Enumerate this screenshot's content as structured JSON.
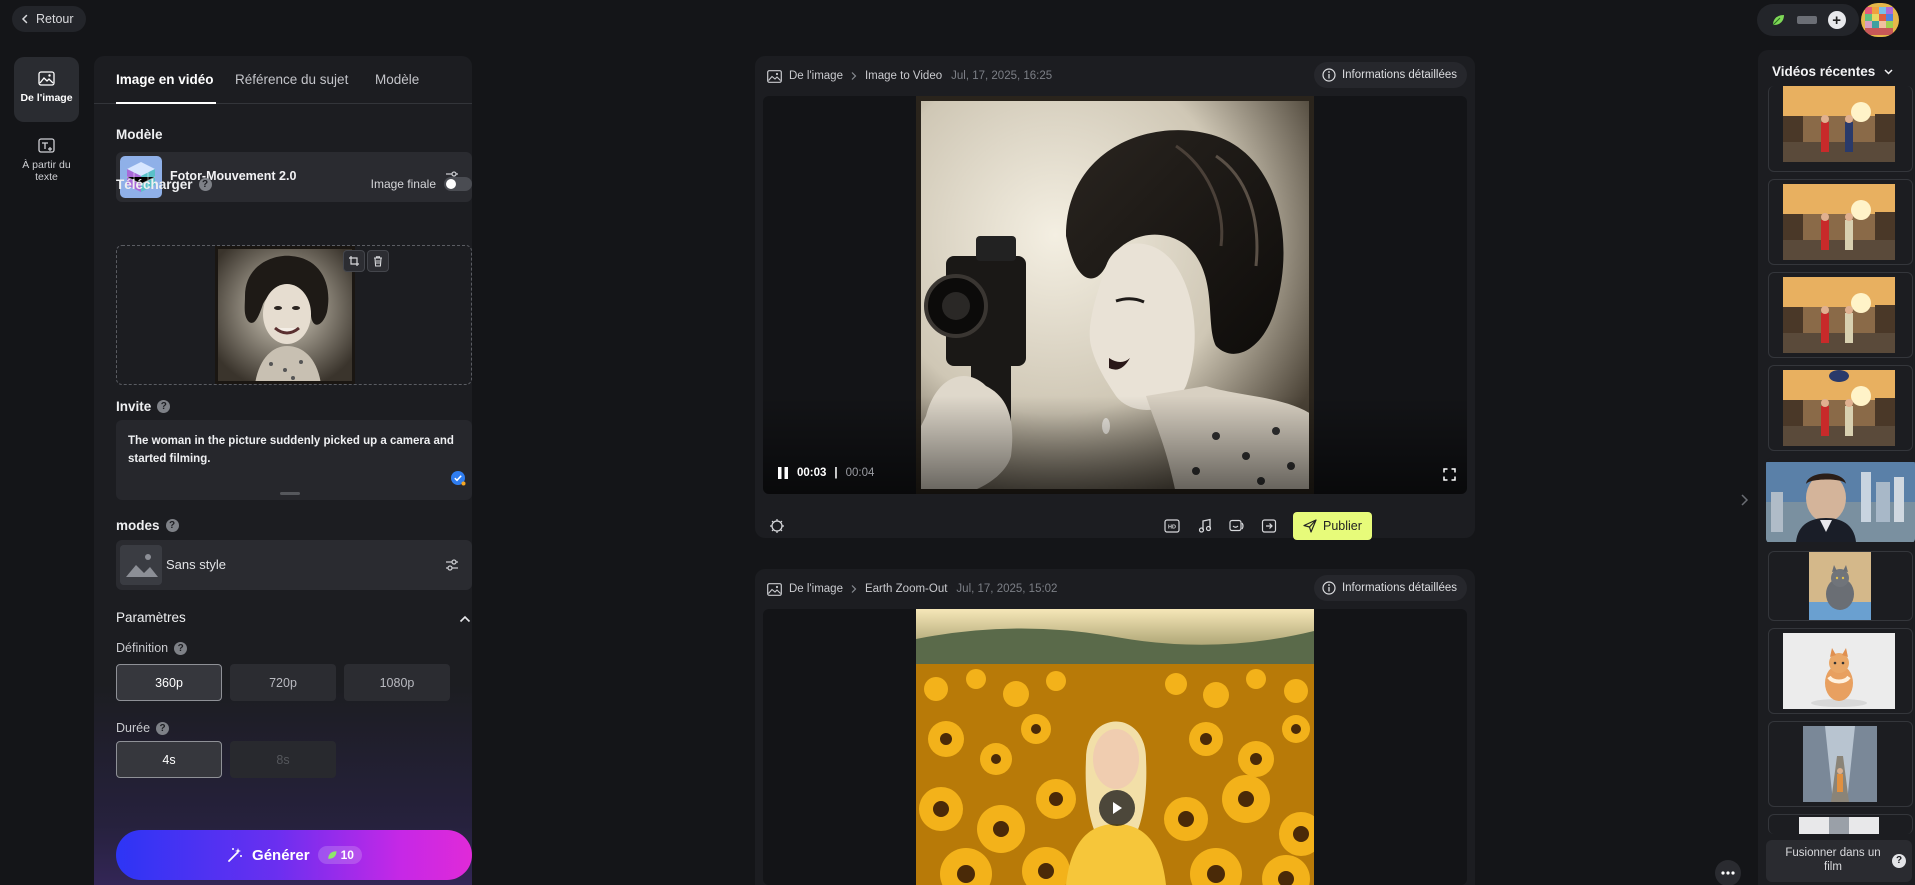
{
  "header": {
    "back_label": "Retour"
  },
  "left_nav": {
    "items": [
      {
        "label": "De l'image",
        "icon": "image-icon"
      },
      {
        "label": "À partir du texte",
        "icon": "text-image-icon"
      }
    ]
  },
  "panel": {
    "tabs": [
      "Image en vidéo",
      "Référence du sujet",
      "Modèle"
    ],
    "model": {
      "label": "Modèle",
      "name": "Fotor-Mouvement 2.0"
    },
    "upload": {
      "label": "Télécharger",
      "final_image_label": "Image finale"
    },
    "prompt": {
      "label": "Invite",
      "text": "The woman in the picture suddenly picked up a camera and started filming."
    },
    "modes": {
      "label": "modes",
      "style_name": "Sans style"
    },
    "params": {
      "label": "Paramètres"
    },
    "definition": {
      "label": "Définition",
      "options": [
        "360p",
        "720p",
        "1080p"
      ],
      "selected": "360p"
    },
    "duration": {
      "label": "Durée",
      "options": [
        "4s",
        "8s"
      ],
      "selected": "4s"
    },
    "generate": {
      "label": "Générer",
      "cost": "10"
    }
  },
  "cards": [
    {
      "crumb_source": "De l'image",
      "crumb_title": "Image to Video",
      "date": "Jul, 17, 2025, 16:25",
      "info_label": "Informations détaillées",
      "time_current": "00:03",
      "time_separator": "|",
      "time_total": "00:04",
      "publish_label": "Publier"
    },
    {
      "crumb_source": "De l'image",
      "crumb_title": "Earth Zoom-Out",
      "date": "Jul, 17, 2025, 15:02",
      "info_label": "Informations détaillées"
    }
  ],
  "recent": {
    "title": "Vidéos récentes",
    "merge_label": "Fusionner dans un film"
  },
  "colors": {
    "accent_publish": "#e7fb7a",
    "generate_start": "#2d35f5",
    "generate_end": "#e02ad8"
  }
}
